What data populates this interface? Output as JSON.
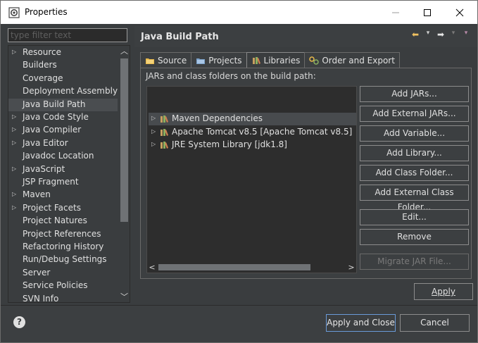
{
  "window": {
    "title": "Properties"
  },
  "nav": {
    "filter_placeholder": "type filter text",
    "items": [
      {
        "label": "Resource",
        "expandable": true
      },
      {
        "label": "Builders",
        "expandable": false
      },
      {
        "label": "Coverage",
        "expandable": false
      },
      {
        "label": "Deployment Assembly",
        "expandable": false
      },
      {
        "label": "Java Build Path",
        "expandable": false,
        "selected": true
      },
      {
        "label": "Java Code Style",
        "expandable": true
      },
      {
        "label": "Java Compiler",
        "expandable": true
      },
      {
        "label": "Java Editor",
        "expandable": true
      },
      {
        "label": "Javadoc Location",
        "expandable": false
      },
      {
        "label": "JavaScript",
        "expandable": true
      },
      {
        "label": "JSP Fragment",
        "expandable": false
      },
      {
        "label": "Maven",
        "expandable": true
      },
      {
        "label": "Project Facets",
        "expandable": true
      },
      {
        "label": "Project Natures",
        "expandable": false
      },
      {
        "label": "Project References",
        "expandable": false
      },
      {
        "label": "Refactoring History",
        "expandable": false
      },
      {
        "label": "Run/Debug Settings",
        "expandable": false
      },
      {
        "label": "Server",
        "expandable": false
      },
      {
        "label": "Service Policies",
        "expandable": false
      },
      {
        "label": "SVN Info",
        "expandable": false
      }
    ]
  },
  "content": {
    "title": "Java Build Path",
    "tabs": [
      {
        "label": "Source",
        "icon": "source-folder-icon"
      },
      {
        "label": "Projects",
        "icon": "projects-icon"
      },
      {
        "label": "Libraries",
        "icon": "libraries-icon",
        "active": true
      },
      {
        "label": "Order and Export",
        "icon": "order-export-icon"
      }
    ],
    "panel_label": "JARs and class folders on the build path:",
    "libraries": [
      {
        "label": "Maven Dependencies",
        "selected": true
      },
      {
        "label": "Apache Tomcat v8.5 [Apache Tomcat v8.5]"
      },
      {
        "label": "JRE System Library [jdk1.8]"
      }
    ],
    "buttons": [
      {
        "label": "Add JARs...",
        "enabled": true
      },
      {
        "label": "Add External JARs...",
        "enabled": true
      },
      {
        "label": "Add Variable...",
        "enabled": true
      },
      {
        "label": "Add Library...",
        "enabled": true
      },
      {
        "label": "Add Class Folder...",
        "enabled": true
      },
      {
        "label": "Add External Class Folder...",
        "enabled": true
      },
      {
        "label": "Edit...",
        "enabled": true
      },
      {
        "label": "Remove",
        "enabled": true
      },
      {
        "label": "Migrate JAR File...",
        "enabled": false
      }
    ],
    "apply_label": "Apply"
  },
  "footer": {
    "help_symbol": "?",
    "apply_close_label": "Apply and Close",
    "cancel_label": "Cancel"
  },
  "colors": {
    "background": "#3c3f41",
    "tree_background": "#2d2d2d",
    "selection": "#484b4e",
    "primary_border": "#6a9ad8",
    "nav_arrow": "#f0c060"
  }
}
